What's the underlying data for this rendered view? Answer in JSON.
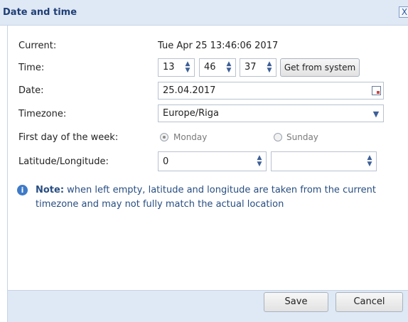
{
  "dialog": {
    "title": "Date and time",
    "close_label": "X"
  },
  "current": {
    "label": "Current:",
    "value": "Tue Apr 25 13:46:06 2017"
  },
  "time": {
    "label": "Time:",
    "hours": "13",
    "minutes": "46",
    "seconds": "37",
    "get_from_system": "Get from system"
  },
  "date": {
    "label": "Date:",
    "value": "25.04.2017"
  },
  "timezone": {
    "label": "Timezone:",
    "value": "Europe/Riga"
  },
  "first_day": {
    "label": "First day of the week:",
    "options": [
      "Monday",
      "Sunday"
    ],
    "selected": "Monday"
  },
  "latlong": {
    "label": "Latitude/Longitude:",
    "latitude": "0",
    "longitude": ""
  },
  "note": {
    "bold": "Note:",
    "text": " when left empty, latitude and longitude are taken from the current timezone and may not fully match the actual location"
  },
  "footer": {
    "save": "Save",
    "cancel": "Cancel"
  },
  "colors": {
    "titlebar": "#dfe8f5",
    "title_text": "#1f3f75",
    "note_text": "#284e82",
    "info_icon": "#3e7ac8"
  }
}
